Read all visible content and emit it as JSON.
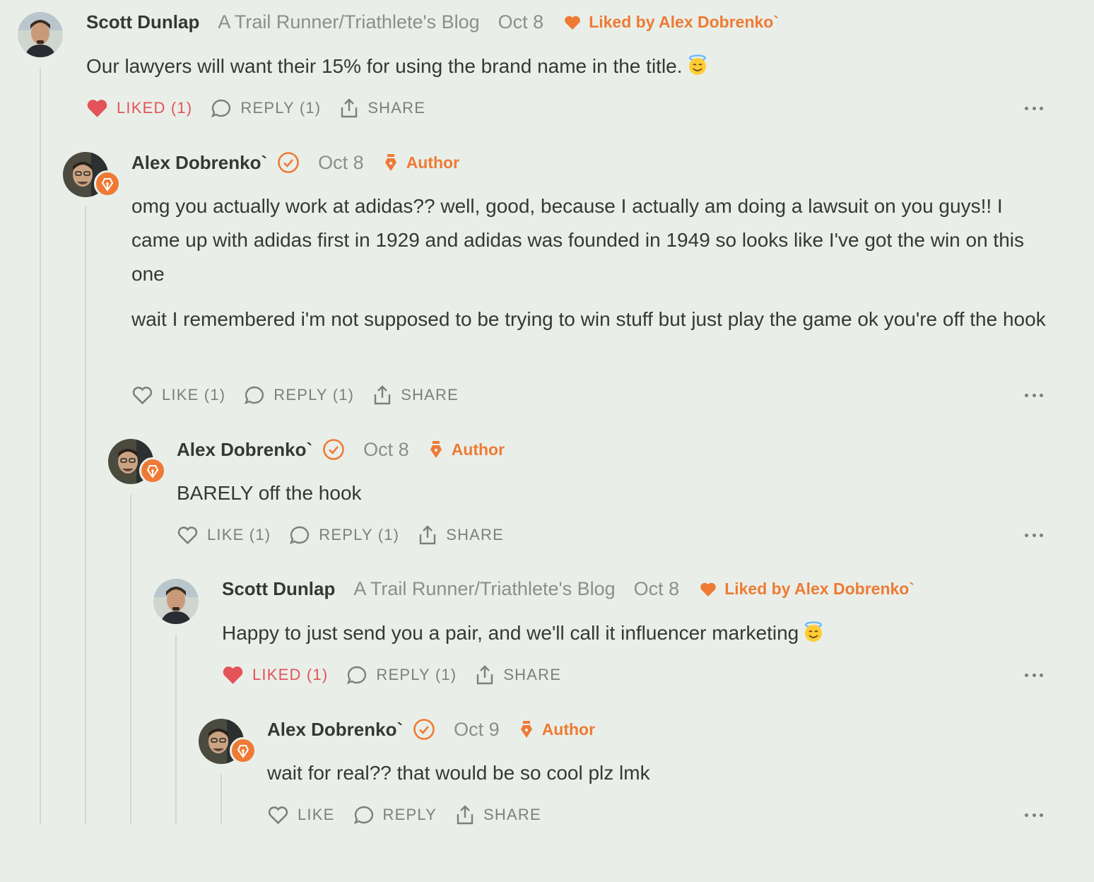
{
  "colors": {
    "accent": "#ef7a35",
    "liked": "#e4525a",
    "muted": "#8a8f8a",
    "text": "#363737",
    "background": "#e9efe8"
  },
  "comments": [
    {
      "name": "Scott Dunlap",
      "publication": "A Trail Runner/Triathlete's Blog",
      "date": "Oct 8",
      "liked_by": "Liked by Alex Dobrenko`",
      "body": [
        "Our lawyers will want their 15% for using the brand name in the title."
      ],
      "emoji": "smiling-face-with-halo",
      "like_label": "LIKED (1)",
      "liked": true,
      "reply_label": "REPLY (1)",
      "share_label": "SHARE"
    },
    {
      "name": "Alex Dobrenko`",
      "date": "Oct 8",
      "author_label": "Author",
      "body": [
        "omg you actually work at adidas?? well, good, because I actually am doing a lawsuit on you guys!! I came up with adidas first in 1929 and adidas was founded in 1949 so looks like I've got the win on this one",
        "wait I remembered i'm not supposed to be trying to win stuff but just play the game ok you're off the hook"
      ],
      "like_label": "LIKE (1)",
      "liked": false,
      "reply_label": "REPLY (1)",
      "share_label": "SHARE"
    },
    {
      "name": "Alex Dobrenko`",
      "date": "Oct 8",
      "author_label": "Author",
      "body": [
        "BARELY off the hook"
      ],
      "like_label": "LIKE (1)",
      "liked": false,
      "reply_label": "REPLY (1)",
      "share_label": "SHARE"
    },
    {
      "name": "Scott Dunlap",
      "publication": "A Trail Runner/Triathlete's Blog",
      "date": "Oct 8",
      "liked_by": "Liked by Alex Dobrenko`",
      "body": [
        "Happy to just send you a pair, and we'll call it influencer marketing"
      ],
      "emoji": "smiling-face-with-halo",
      "like_label": "LIKED (1)",
      "liked": true,
      "reply_label": "REPLY (1)",
      "share_label": "SHARE"
    },
    {
      "name": "Alex Dobrenko`",
      "date": "Oct 9",
      "author_label": "Author",
      "body": [
        "wait for real?? that would be so cool plz lmk"
      ],
      "like_label": "LIKE",
      "liked": false,
      "reply_label": "REPLY",
      "share_label": "SHARE"
    }
  ]
}
